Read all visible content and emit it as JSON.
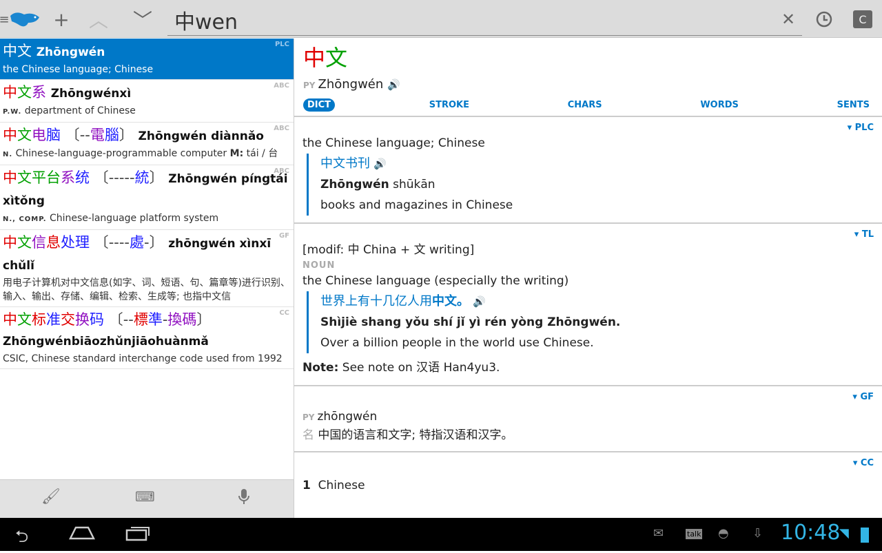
{
  "topbar": {
    "search_value": "中wen",
    "icons": [
      "menu-icon",
      "dolphin-logo",
      "plus-icon",
      "chevron-up-icon",
      "chevron-down-icon",
      "clear-icon",
      "history-icon",
      "clipboard-icon"
    ],
    "c_label": "C"
  },
  "results": [
    {
      "chars": [
        [
          "中",
          1
        ],
        [
          "文",
          2
        ]
      ],
      "trad": [],
      "pinyin": "Zhōngwén",
      "pos": "",
      "def": "the Chinese language; Chinese",
      "src": "PLC"
    },
    {
      "chars": [
        [
          "中",
          1
        ],
        [
          "文",
          2
        ],
        [
          "系",
          4
        ]
      ],
      "trad": [],
      "pinyin": "Zhōngwénxì",
      "pos": "P.W.",
      "def": "department of Chinese",
      "extra_lbl": "",
      "src": "ABC"
    },
    {
      "chars": [
        [
          "中",
          1
        ],
        [
          "文",
          2
        ],
        [
          "电",
          4
        ],
        [
          "脑",
          3
        ]
      ],
      "trad": [
        [
          "--",
          0
        ],
        [
          "電",
          4
        ],
        [
          "腦",
          3
        ]
      ],
      "pinyin": "Zhōngwén diànnǎo",
      "pos": "N.",
      "def": "Chinese-language-programmable computer",
      "m_label": "M:",
      "m_value": "tái / 台",
      "src": "ABC"
    },
    {
      "chars": [
        [
          "中",
          1
        ],
        [
          "文",
          2
        ],
        [
          "平",
          2
        ],
        [
          "台",
          2
        ],
        [
          "系",
          4
        ],
        [
          "统",
          3
        ]
      ],
      "trad": [
        [
          "-----",
          0
        ],
        [
          "統",
          3
        ]
      ],
      "pinyin": "Zhōngwén píngtái xìtǒng",
      "pos": "N., COMP.",
      "def": "Chinese-language platform system",
      "src": "ABC"
    },
    {
      "chars": [
        [
          "中",
          1
        ],
        [
          "文",
          2
        ],
        [
          "信",
          4
        ],
        [
          "息",
          1
        ],
        [
          "处",
          3
        ],
        [
          "理",
          3
        ]
      ],
      "trad": [
        [
          "----",
          0
        ],
        [
          "處",
          3
        ],
        [
          "-",
          0
        ]
      ],
      "pinyin": "zhōngwén xìnxī chǔlǐ",
      "pos": "",
      "def": "用电子计算机对中文信息(如字、词、短语、句、篇章等)进行识别、输入、输出、存储、编辑、检索、生成等; 也指中文信",
      "src": "GF"
    },
    {
      "chars": [
        [
          "中",
          1
        ],
        [
          "文",
          2
        ],
        [
          "标",
          1
        ],
        [
          "准",
          3
        ],
        [
          "交",
          1
        ],
        [
          "换",
          4
        ],
        [
          "码",
          3
        ]
      ],
      "trad": [
        [
          "--",
          0
        ],
        [
          "標",
          1
        ],
        [
          "準",
          3
        ],
        [
          "-",
          0
        ],
        [
          "換",
          4
        ],
        [
          "碼",
          4
        ]
      ],
      "pinyin": "Zhōngwénbiāozhǔnjiāohuànmǎ",
      "pos": "",
      "def": "CSIC, Chinese standard interchange code used from 1992",
      "src": "CC"
    }
  ],
  "left_toolbar": [
    "brush-icon",
    "keyboard-icon",
    "microphone-icon"
  ],
  "detail": {
    "word": [
      [
        "中",
        1
      ],
      [
        "文",
        2
      ]
    ],
    "py_label": "PY",
    "pinyin": "Zhōngwén",
    "tabs": [
      "DICT",
      "STROKE",
      "CHARS",
      "WORDS",
      "SENTS"
    ],
    "plc": {
      "label": "▾ PLC",
      "def": "the Chinese language; Chinese",
      "ex_zh": "中文书刊",
      "ex_py_bold": "Zhōngwén",
      "ex_py": " shūkān",
      "ex_en": "books and magazines in Chinese"
    },
    "tl": {
      "label": "▾ TL",
      "modif": "[modif: 中 China + 文 writing]",
      "pos": "NOUN",
      "def": "the Chinese language (especially the writing)",
      "ex_zh": "世界上有十几亿人用",
      "ex_zh_bold": "中文。",
      "ex_py": "Shìjiè shang yǒu shí jǐ yì rén yòng ",
      "ex_py_bold": "Zhōngwén.",
      "ex_en": "Over a billion people in the world use Chinese.",
      "note_lbl": "Note:",
      "note": " See note on 汉语 Han4yu3."
    },
    "gf": {
      "label": "▾ GF",
      "py_label": "PY",
      "pinyin": "zhōngwén",
      "pos": "名",
      "def": "中国的语言和文字; 特指汉语和汉字。"
    },
    "cc": {
      "label": "▾ CC",
      "num": "1",
      "def": "Chinese"
    }
  },
  "status": {
    "time": "10:48",
    "talk": "talk"
  },
  "colors": {
    "accent": "#0078c8",
    "tone1": "#e00000",
    "tone2": "#00a000",
    "tone3": "#2020ff",
    "tone4": "#9010c0",
    "clock": "#33b5e5"
  }
}
